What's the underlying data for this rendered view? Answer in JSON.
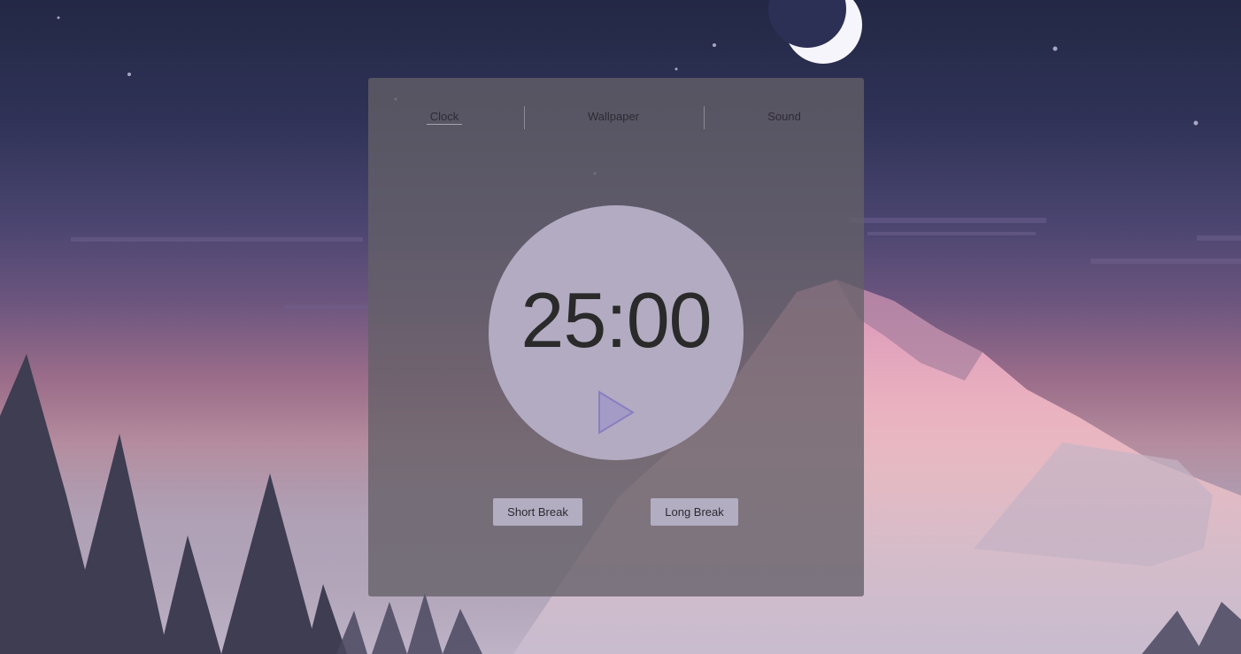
{
  "tabs": [
    {
      "label": "Clock",
      "active": true
    },
    {
      "label": "Wallpaper",
      "active": false
    },
    {
      "label": "Sound",
      "active": false
    }
  ],
  "timer": {
    "display": "25:00",
    "play_icon": "play-icon"
  },
  "breaks": {
    "short_label": "Short Break",
    "long_label": "Long Break"
  },
  "colors": {
    "panel": "#646068",
    "circle": "#b3abc1",
    "play_icon": "#8a7fc0",
    "button": "#b3adc2"
  }
}
